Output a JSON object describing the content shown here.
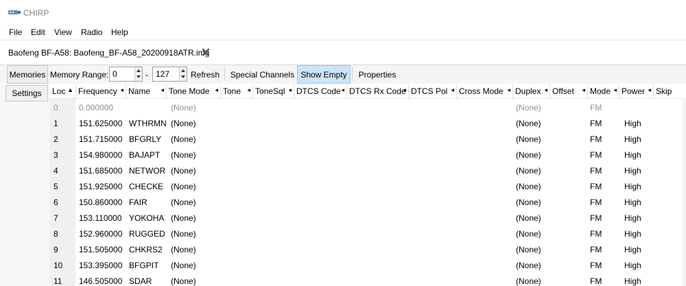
{
  "window": {
    "title": "CHIRP"
  },
  "menu": [
    "File",
    "Edit",
    "View",
    "Radio",
    "Help"
  ],
  "tab": {
    "label": "Baofeng BF-A58: Baofeng_BF-A58_20200918ATR.img"
  },
  "toolbar": {
    "memories_label": "Memories",
    "memory_range_label": "Memory Range:",
    "range_start": "0",
    "range_dash": "-",
    "range_end": "127",
    "refresh_label": "Refresh",
    "special_channels_label": "Special Channels",
    "show_empty_label": "Show Empty",
    "properties_label": "Properties"
  },
  "sidebar": {
    "settings_label": "Settings"
  },
  "columns": [
    "Loc",
    "Frequency",
    "Name",
    "Tone Mode",
    "Tone",
    "ToneSql",
    "DTCS Code",
    "DTCS Rx Code",
    "DTCS Pol",
    "Cross Mode",
    "Duplex",
    "Offset",
    "Mode",
    "Power",
    "Skip"
  ],
  "rows": [
    {
      "loc": "0",
      "frequency": "0.000000",
      "name": "",
      "tone_mode": "(None)",
      "duplex": "(None)",
      "mode": "FM",
      "power": ""
    },
    {
      "loc": "1",
      "frequency": "151.625000",
      "name": "WTHRMN",
      "tone_mode": "(None)",
      "duplex": "(None)",
      "mode": "FM",
      "power": "High"
    },
    {
      "loc": "2",
      "frequency": "151.715000",
      "name": "BFGRLY",
      "tone_mode": "(None)",
      "duplex": "(None)",
      "mode": "FM",
      "power": "High"
    },
    {
      "loc": "3",
      "frequency": "154.980000",
      "name": "BAJAPT",
      "tone_mode": "(None)",
      "duplex": "(None)",
      "mode": "FM",
      "power": "High"
    },
    {
      "loc": "4",
      "frequency": "151.685000",
      "name": "NETWOR",
      "tone_mode": "(None)",
      "duplex": "(None)",
      "mode": "FM",
      "power": "High"
    },
    {
      "loc": "5",
      "frequency": "151.925000",
      "name": "CHECKE",
      "tone_mode": "(None)",
      "duplex": "(None)",
      "mode": "FM",
      "power": "High"
    },
    {
      "loc": "6",
      "frequency": "150.860000",
      "name": "FAIR",
      "tone_mode": "(None)",
      "duplex": "(None)",
      "mode": "FM",
      "power": "High"
    },
    {
      "loc": "7",
      "frequency": "153.110000",
      "name": "YOKOHA",
      "tone_mode": "(None)",
      "duplex": "(None)",
      "mode": "FM",
      "power": "High"
    },
    {
      "loc": "8",
      "frequency": "152.960000",
      "name": "RUGGED",
      "tone_mode": "(None)",
      "duplex": "(None)",
      "mode": "FM",
      "power": "High"
    },
    {
      "loc": "9",
      "frequency": "151.505000",
      "name": "CHKRS2",
      "tone_mode": "(None)",
      "duplex": "(None)",
      "mode": "FM",
      "power": "High"
    },
    {
      "loc": "10",
      "frequency": "153.395000",
      "name": "BFGPIT",
      "tone_mode": "(None)",
      "duplex": "(None)",
      "mode": "FM",
      "power": "High"
    },
    {
      "loc": "11",
      "frequency": "146.505000",
      "name": "SDAR",
      "tone_mode": "(None)",
      "duplex": "(None)",
      "mode": "FM",
      "power": "High"
    }
  ],
  "colors": {
    "accent_selected": "#cce4f7",
    "desktop": "#1a73c8"
  }
}
